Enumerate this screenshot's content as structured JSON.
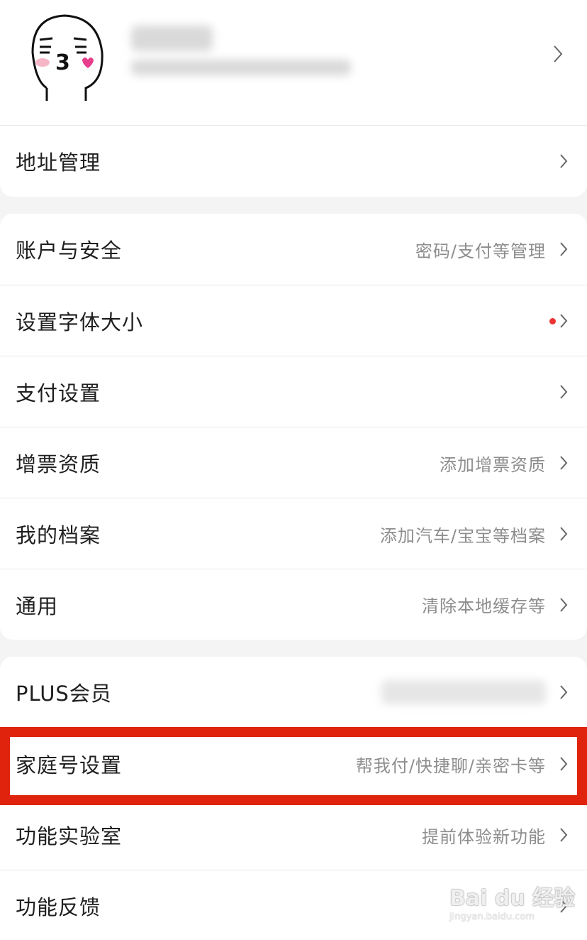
{
  "profile": {
    "name_blurred": "",
    "sub_blurred": ""
  },
  "rows": {
    "address": {
      "label": "地址管理"
    },
    "account": {
      "label": "账户与安全",
      "hint": "密码/支付等管理"
    },
    "font_size": {
      "label": "设置字体大小"
    },
    "payment": {
      "label": "支付设置"
    },
    "invoice": {
      "label": "增票资质",
      "hint": "添加增票资质"
    },
    "archive": {
      "label": "我的档案",
      "hint": "添加汽车/宝宝等档案"
    },
    "general": {
      "label": "通用",
      "hint": "清除本地缓存等"
    },
    "plus": {
      "label": "PLUS会员"
    },
    "family": {
      "label": "家庭号设置",
      "hint": "帮我付/快捷聊/亲密卡等"
    },
    "lab": {
      "label": "功能实验室",
      "hint": "提前体验新功能"
    },
    "feedback": {
      "label": "功能反馈"
    }
  },
  "watermark": {
    "main": "Bai du 经验",
    "sub": "jingyan.baidu.com"
  },
  "colors": {
    "highlight": "#e0230c",
    "badge": "#e33333",
    "hint": "#8d8d8d"
  }
}
